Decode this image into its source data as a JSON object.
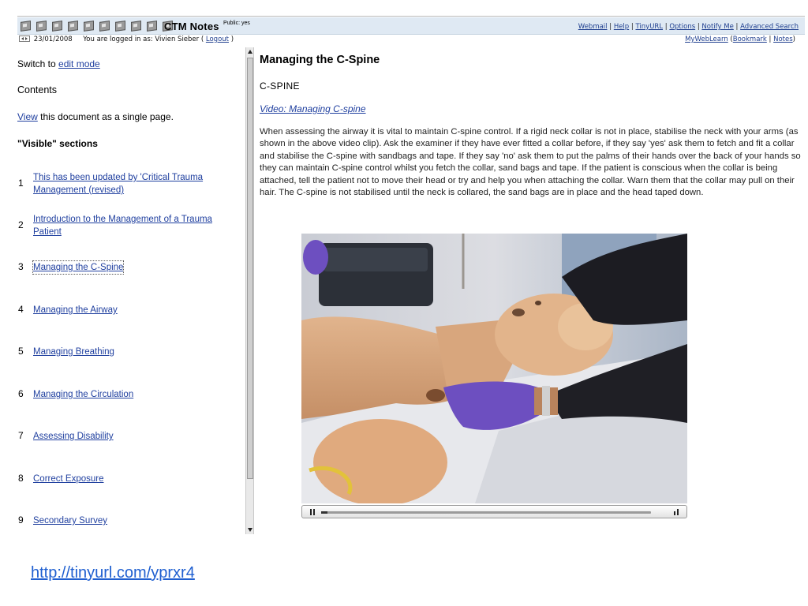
{
  "header": {
    "app_title": "CTM Notes",
    "app_sub": "Public: yes",
    "links": [
      "Webmail",
      "Help",
      "TinyURL",
      "Options",
      "Notify Me",
      "Advanced Search"
    ],
    "date": "23/01/2008",
    "login_prefix": "You are logged in as: Vivien Sieber (",
    "logout": "Logout",
    "login_suffix": ")",
    "mywebl": "MyWebLearn",
    "bookmark": "Bookmark",
    "notes": "Notes",
    "toolbar_icons": [
      "home-icon",
      "notes-icon",
      "book-icon",
      "cube-icon",
      "cube-icon",
      "cube-icon",
      "cube-icon",
      "cube-icon",
      "cube-icon",
      "edit-icon"
    ]
  },
  "sidebar": {
    "switch_prefix": "Switch to ",
    "edit_mode": "edit mode",
    "contents": "Contents",
    "view": "View",
    "view_suffix": " this document as a single page.",
    "visible_sections": "\"Visible\" sections",
    "sections": [
      {
        "num": "1",
        "label": "This has been updated by 'Critical Trauma Management (revised)"
      },
      {
        "num": "2",
        "label": "Introduction to the Management of a Trauma Patient"
      },
      {
        "num": "3",
        "label": "Managing the C-Spine"
      },
      {
        "num": "4",
        "label": "Managing the Airway"
      },
      {
        "num": "5",
        "label": "Managing Breathing"
      },
      {
        "num": "6",
        "label": "Managing the Circulation"
      },
      {
        "num": "7",
        "label": "Assessing Disability"
      },
      {
        "num": "8",
        "label": "Correct Exposure"
      },
      {
        "num": "9",
        "label": "Secondary Survey"
      }
    ]
  },
  "main": {
    "title": "Managing the C-Spine",
    "section_label": "C-SPINE",
    "video_link": "Video: Managing C-spine",
    "body": "When assessing the airway it is vital to maintain C-spine control. If a rigid neck collar is not in place, stabilise the neck with your arms (as shown in the above video clip). Ask the examiner if they have ever fitted a collar before, if they say 'yes' ask them to fetch and fit a collar and stabilise the C-spine with sandbags and tape. If they say 'no' ask them to put the palms of their hands over the back of your hands so they can maintain C-spine control whilst you fetch the collar, sand bags and tape. If the patient is conscious when the collar is being attached, tell the patient not to move their head or try and help you when attaching the collar. Warn them that the collar may pull on their hair. The C-spine is not stabilised until the neck is collared, the sand bags are in place and the head taped down.",
    "video_progress": 0.02
  },
  "footer": {
    "url": "http://tinyurl.com/yprxr4"
  }
}
